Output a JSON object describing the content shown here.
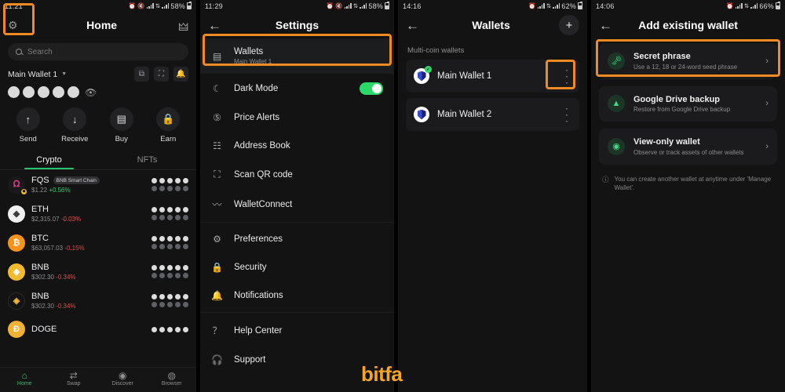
{
  "panels": {
    "home": {
      "status": {
        "time": "11:21",
        "battery": "58%"
      },
      "appbar": {
        "title": "Home",
        "gear_icon": "gear-icon",
        "link_icon": "walletconnect-icon"
      },
      "search": {
        "placeholder": "Search"
      },
      "wallet": {
        "name": "Main Wallet 1",
        "caret": "▾"
      },
      "header_icons": [
        "copy-icon",
        "scan-icon",
        "bell-icon"
      ],
      "balance_hidden_dots": 5,
      "actions": [
        {
          "label": "Send",
          "icon": "arrow-up-icon",
          "glyph": "↑"
        },
        {
          "label": "Receive",
          "icon": "arrow-down-icon",
          "glyph": "↓"
        },
        {
          "label": "Buy",
          "icon": "card-icon",
          "glyph": "▭"
        },
        {
          "label": "Earn",
          "icon": "lock-icon",
          "glyph": "🔒"
        }
      ],
      "tabs": [
        {
          "label": "Crypto",
          "active": true
        },
        {
          "label": "NFTs",
          "active": false
        }
      ],
      "coins": [
        {
          "symbol": "FQS",
          "chip": "BNB Smart Chain",
          "price": "$1.22",
          "change": "+0.56%",
          "dir": "up",
          "icon": "fqs-token-icon"
        },
        {
          "symbol": "ETH",
          "chip": "",
          "price": "$2,315.07",
          "change": "-0.03%",
          "dir": "down",
          "icon": "eth-token-icon"
        },
        {
          "symbol": "BTC",
          "chip": "",
          "price": "$63,057.03",
          "change": "-0.15%",
          "dir": "down",
          "icon": "btc-token-icon"
        },
        {
          "symbol": "BNB",
          "chip": "",
          "price": "$302.30",
          "change": "-0.34%",
          "dir": "down",
          "icon": "bnb-token-icon"
        },
        {
          "symbol": "BNB",
          "chip": "",
          "price": "$302.30",
          "change": "-0.34%",
          "dir": "down",
          "icon": "bnb-token-icon"
        },
        {
          "symbol": "DOGE",
          "chip": "",
          "price": "",
          "change": "",
          "dir": "",
          "icon": "doge-token-icon"
        }
      ],
      "bottom_nav": [
        {
          "label": "Home",
          "icon": "home-icon",
          "glyph": "⌂",
          "active": true
        },
        {
          "label": "Swap",
          "icon": "swap-icon",
          "glyph": "⇄",
          "active": false
        },
        {
          "label": "Discover",
          "icon": "compass-icon",
          "glyph": "◉",
          "active": false
        },
        {
          "label": "Browser",
          "icon": "browser-icon",
          "glyph": "◍",
          "active": false
        }
      ]
    },
    "settings": {
      "status": {
        "time": "11:29",
        "battery": "58%"
      },
      "appbar": {
        "title": "Settings",
        "back_icon": "back-arrow-icon"
      },
      "items": [
        {
          "label": "Wallets",
          "sub": "Main Wallet 1",
          "icon": "wallet-icon",
          "glyph": "▤",
          "highlighted": true
        },
        {
          "label": "Dark Mode",
          "sub": "",
          "icon": "moon-icon",
          "glyph": "☾",
          "toggle": true
        },
        {
          "label": "Price Alerts",
          "sub": "",
          "icon": "price-alert-icon",
          "glyph": "⑤"
        },
        {
          "label": "Address Book",
          "sub": "",
          "icon": "address-book-icon",
          "glyph": "☷"
        },
        {
          "label": "Scan QR code",
          "sub": "",
          "icon": "qr-scan-icon",
          "glyph": "⛶"
        },
        {
          "label": "WalletConnect",
          "sub": "",
          "icon": "walletconnect-icon",
          "glyph": "〰"
        },
        {
          "label": "Preferences",
          "sub": "",
          "icon": "gear-icon",
          "glyph": "✿"
        },
        {
          "label": "Security",
          "sub": "",
          "icon": "lock-icon",
          "glyph": "🔒"
        },
        {
          "label": "Notifications",
          "sub": "",
          "icon": "bell-icon",
          "glyph": "🔔"
        },
        {
          "label": "Help Center",
          "sub": "",
          "icon": "help-icon",
          "glyph": "?"
        },
        {
          "label": "Support",
          "sub": "",
          "icon": "headset-icon",
          "glyph": "🎧"
        }
      ]
    },
    "wallets": {
      "status": {
        "time": "14:16",
        "battery": "62%"
      },
      "appbar": {
        "title": "Wallets",
        "back_icon": "back-arrow-icon",
        "add_icon": "plus-icon",
        "add_glyph": "+"
      },
      "section_label": "Multi-coin wallets",
      "list": [
        {
          "name": "Main Wallet 1",
          "selected": true,
          "menu_highlighted": true
        },
        {
          "name": "Main Wallet 2",
          "selected": false,
          "menu_highlighted": false
        }
      ]
    },
    "add_wallet": {
      "status": {
        "time": "14:06",
        "battery": "66%"
      },
      "appbar": {
        "title": "Add existing wallet",
        "back_icon": "back-arrow-icon"
      },
      "options": [
        {
          "title": "Secret phrase",
          "sub": "Use a 12, 18 or 24-word seed phrase",
          "icon": "key-icon",
          "glyph": "🗝",
          "highlighted": true
        },
        {
          "title": "Google Drive backup",
          "sub": "Restore from Google Drive backup",
          "icon": "google-drive-icon",
          "glyph": "▲",
          "highlighted": false
        },
        {
          "title": "View-only wallet",
          "sub": "Observe or track assets of other wallets",
          "icon": "eye-icon",
          "glyph": "◉",
          "highlighted": false
        }
      ],
      "note": "You can create another wallet at anytime under 'Manage Wallet'."
    }
  },
  "watermark": {
    "text": "bitfa",
    "color": "#f5a623"
  },
  "accent": {
    "highlight": "#f08a24",
    "green": "#2bd96b",
    "up": "#2ecc71",
    "down": "#e04a4a"
  }
}
